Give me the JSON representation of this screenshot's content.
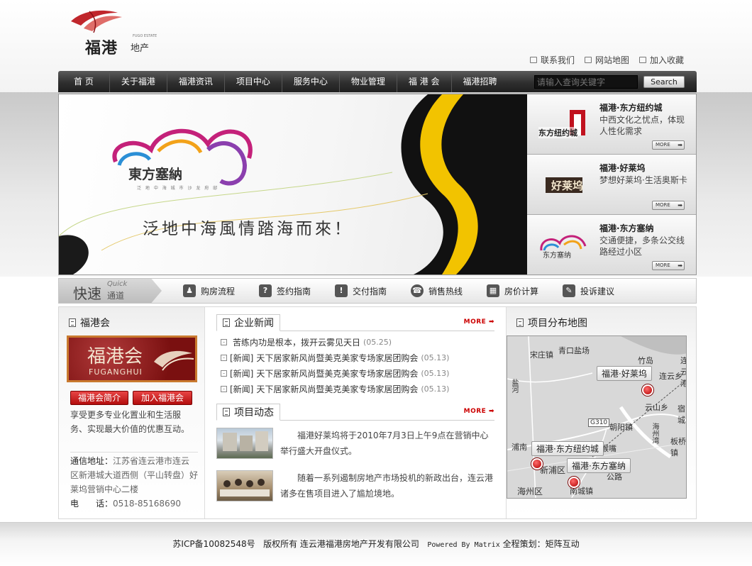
{
  "header": {
    "logo_name": "福港",
    "logo_sub": "地产",
    "logo_tag": "FUGO ESTATE",
    "links": [
      {
        "label": "联系我们"
      },
      {
        "label": "网站地图"
      },
      {
        "label": "加入收藏"
      }
    ]
  },
  "nav": {
    "items": [
      "首 页",
      "关于福港",
      "福港资讯",
      "项目中心",
      "服务中心",
      "物业管理",
      "福 港 会",
      "福港招聘"
    ],
    "search_placeholder": "请输入查询关键字",
    "search_label": "Search"
  },
  "banner": {
    "brand": "東方塞納",
    "brand_small": "泛 地 中 海 城 市 沙 龙 府 邸",
    "slogan": "泛地中海風情踏海而來！",
    "side": [
      {
        "title": "福港·东方纽约城",
        "desc": "中西文化之忧点，体现人性化需求",
        "logo_text": "东方纽约城",
        "more": "MORE"
      },
      {
        "title": "福港·好莱坞",
        "desc": "梦想好莱坞·生活奥斯卡",
        "logo_text": "好莱坞",
        "more": "MORE"
      },
      {
        "title": "福港·东方塞纳",
        "desc": "交通便捷，多条公交线路经过小区",
        "logo_text": "东方塞纳",
        "more": "MORE"
      }
    ]
  },
  "quick": {
    "label_cn": "快速",
    "label_en": "Quick",
    "label_cn2": "通道",
    "items": [
      {
        "label": "购房流程",
        "icon": "person-icon"
      },
      {
        "label": "签约指南",
        "icon": "question-icon"
      },
      {
        "label": "交付指南",
        "icon": "exclamation-icon"
      },
      {
        "label": "销售热线",
        "icon": "phone-icon"
      },
      {
        "label": "房价计算",
        "icon": "calculator-icon"
      },
      {
        "label": "投诉建议",
        "icon": "chat-icon"
      }
    ]
  },
  "left": {
    "title": "福港会",
    "img_cn": "福港会",
    "img_en": "FUGANGHUI",
    "btn_intro": "福港会简介",
    "btn_join": "加入福港会",
    "desc": "享受更多专业化置业和生活服务、实现最大价值的优惠互动。",
    "addr_label": "通信地址：",
    "addr": "江苏省连云港市连云区新港城大道西侧（平山转盘）好莱坞营销中心二楼",
    "tel_label": "电　　话：",
    "tel": "0518-85168690"
  },
  "news": {
    "title": "企业新闻",
    "more": "MORE",
    "items": [
      {
        "tag": "",
        "text": "苦练内功是根本，拨开云雾见天日",
        "date": "(05.25)"
      },
      {
        "tag": "[新闻]",
        "text": "天下居家新风尚暨美克美家专场家居团购会",
        "date": "(05.13)"
      },
      {
        "tag": "[新闻]",
        "text": "天下居家新风尚暨美克美家专场家居团购会",
        "date": "(05.13)"
      },
      {
        "tag": "[新闻]",
        "text": "天下居家新风尚暨美克美家专场家居团购会",
        "date": "(05.13)"
      }
    ]
  },
  "projects": {
    "title": "项目动态",
    "more": "MORE",
    "items": [
      {
        "text": "福港好莱坞将于2010年7月3日上午9点在营销中心举行盛大开盘仪式。"
      },
      {
        "text": "随着一系列遏制房地产市场投机的新政出台，连云港诸多在售项目进入了尴尬境地。"
      }
    ]
  },
  "map": {
    "title": "项目分布地图",
    "labels": [
      "青口盐场",
      "宋庄镇",
      "竹岛",
      "连云港",
      "连云乡",
      "云山乡",
      "宿城",
      "朝阳镇",
      "G310",
      "板桥镇",
      "浦南",
      "新浦区",
      "海州区",
      "南城镇",
      "公路",
      "盐河",
      "猴嘴",
      "海州湾"
    ],
    "tags": [
      "福港·好莱坞",
      "福港·东方纽约城",
      "福港·东方塞纳"
    ]
  },
  "footer": {
    "icp": "苏ICP备10082548号",
    "rights": "版权所有 连云港福港房地产开发有限公司",
    "powered": "Powered By Matrix",
    "plan_label": "全程策划：",
    "plan": "矩阵互动"
  },
  "colors": {
    "accent": "#b30d0d",
    "nav_bg": "#2f2f2f"
  }
}
